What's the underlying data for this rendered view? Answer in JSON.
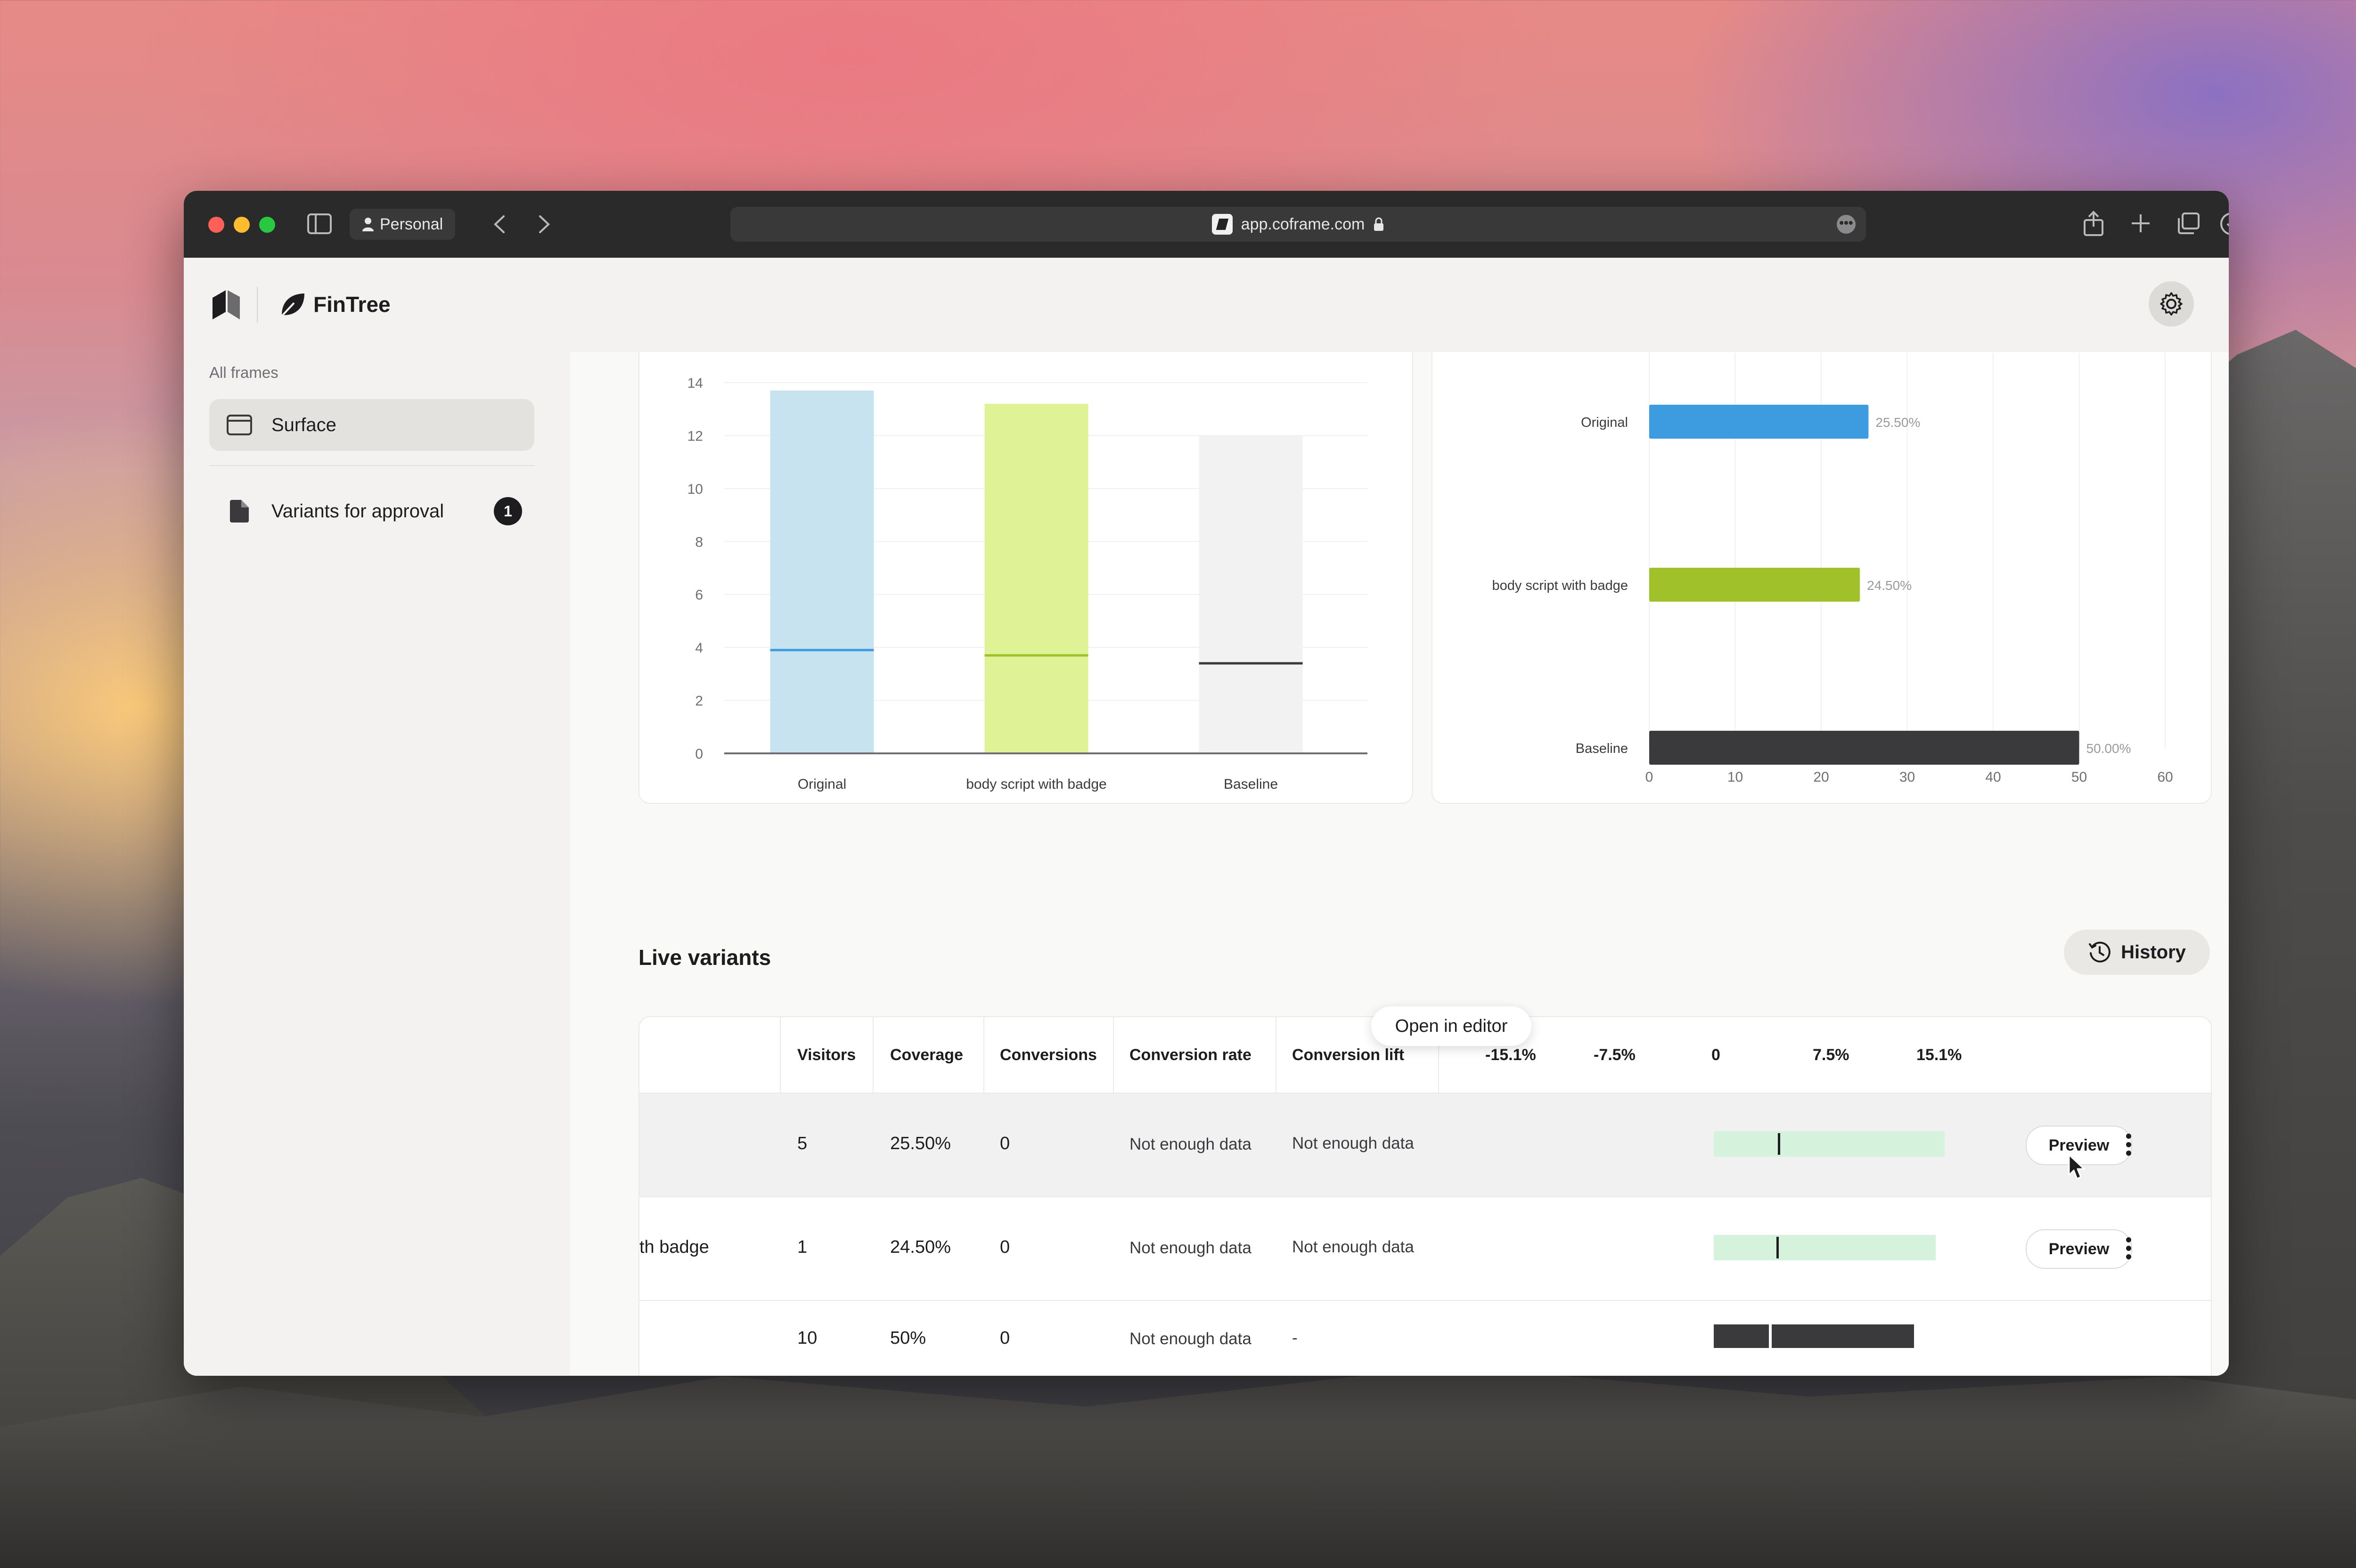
{
  "browser": {
    "profile": "Personal",
    "url": "app.coframe.com"
  },
  "app": {
    "name": "FinTree"
  },
  "sidebar": {
    "section_label": "All frames",
    "items": [
      {
        "label": "Surface",
        "icon": "window-icon",
        "active": true
      },
      {
        "label": "Variants for approval",
        "icon": "document-icon",
        "badge": "1"
      }
    ]
  },
  "chart_data": [
    {
      "type": "bar",
      "categories": [
        "Original",
        "body script with badge",
        "Baseline"
      ],
      "values": [
        13.7,
        13.2,
        12.0
      ],
      "markers": [
        3.9,
        3.7,
        3.4
      ],
      "colors": [
        "#c8e3f0",
        "#dff295",
        "#f2f2f2"
      ],
      "marker_colors": [
        "#3d9be0",
        "#a0c12a",
        "#3a3a3c"
      ],
      "ylim": [
        0,
        14
      ],
      "yticks": [
        0,
        2,
        4,
        6,
        8,
        10,
        12,
        14
      ],
      "title": "",
      "xlabel": "",
      "ylabel": ""
    },
    {
      "type": "bar",
      "orientation": "horizontal",
      "categories": [
        "Original",
        "body script with badge",
        "Baseline"
      ],
      "values": [
        25.5,
        24.5,
        50.0
      ],
      "labels": [
        "25.50%",
        "24.50%",
        "50.00%"
      ],
      "colors": [
        "#3d9be0",
        "#a0c12a",
        "#3a3a3c"
      ],
      "xlim": [
        0,
        60
      ],
      "xticks": [
        0,
        10,
        20,
        30,
        40,
        50,
        60
      ],
      "title": "",
      "xlabel": "",
      "ylabel": ""
    }
  ],
  "live_variants": {
    "title": "Live variants",
    "history_label": "History",
    "columns": [
      "Visitors",
      "Coverage",
      "Conversions",
      "Conversion rate",
      "Conversion lift"
    ],
    "scale_labels": [
      "-15.1%",
      "-7.5%",
      "0",
      "7.5%",
      "15.1%"
    ],
    "rows": [
      {
        "name": "",
        "visitors": "5",
        "coverage": "25.50%",
        "conversions": "0",
        "rate": "Not enough data",
        "lift": "Not enough data",
        "preview": "Preview",
        "ci": {
          "from": 0,
          "to": 15.1,
          "mark": 4.2
        }
      },
      {
        "name": "th badge",
        "visitors": "1",
        "coverage": "24.50%",
        "conversions": "0",
        "rate": "Not enough data",
        "lift": "Not enough data",
        "preview": "Preview",
        "ci": {
          "from": 0,
          "to": 14.5,
          "mark": 4.1
        }
      },
      {
        "name": "",
        "visitors": "10",
        "coverage": "50%",
        "conversions": "0",
        "rate": "Not enough data",
        "lift": "-",
        "ci": {
          "from": 0,
          "to": 13.1,
          "mark": 3.6
        }
      }
    ],
    "tooltip": "Open in editor"
  }
}
